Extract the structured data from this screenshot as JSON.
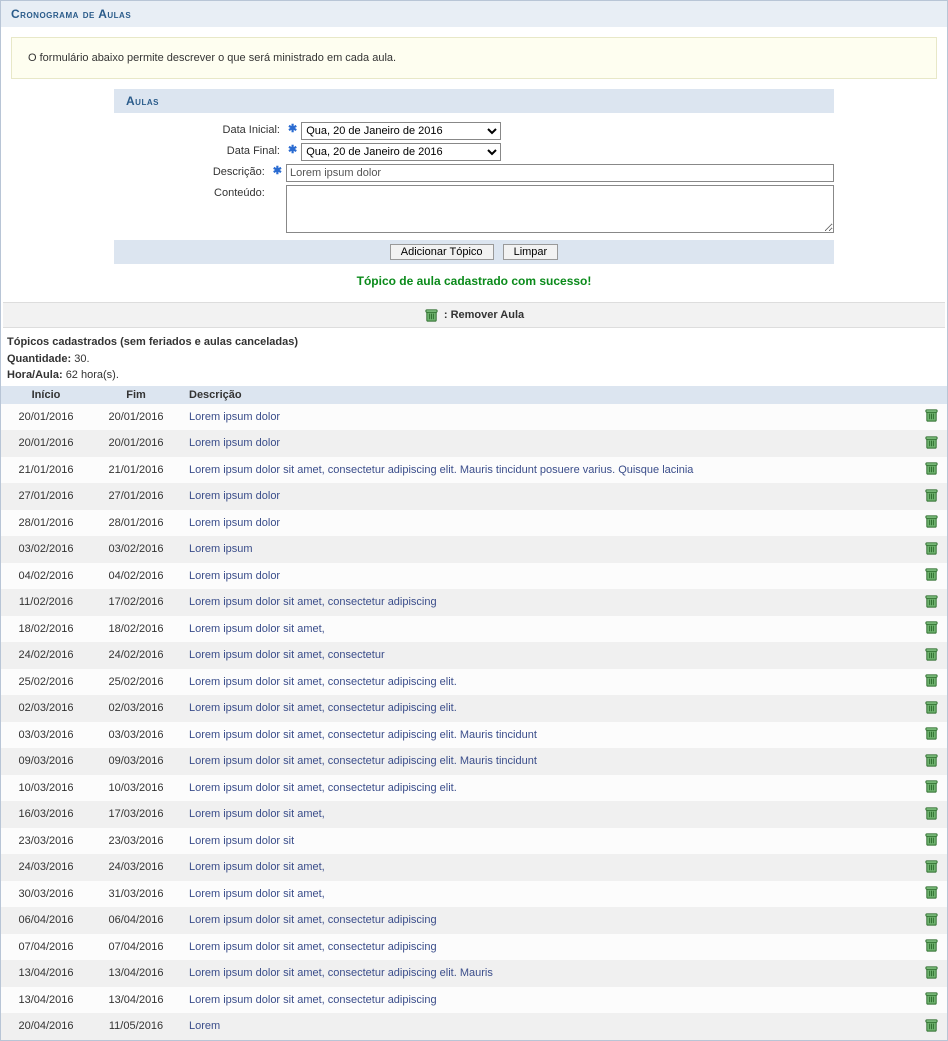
{
  "module_title": "Cronograma de Aulas",
  "info_text": "O formulário abaixo permite descrever o que será ministrado em cada aula.",
  "form": {
    "section_title": "Aulas",
    "labels": {
      "data_inicial": "Data Inicial:",
      "data_final": "Data Final:",
      "descricao": "Descrição:",
      "conteudo": "Conteúdo:"
    },
    "values": {
      "data_inicial": "Qua, 20 de Janeiro de 2016",
      "data_final": "Qua, 20 de Janeiro de 2016",
      "descricao": "Lorem ipsum dolor",
      "conteudo": ""
    },
    "buttons": {
      "adicionar": "Adicionar Tópico",
      "limpar": "Limpar"
    }
  },
  "success_message": "Tópico de aula cadastrado com sucesso!",
  "legend": {
    "remover_label": ": Remover Aula"
  },
  "meta": {
    "topicos_label": "Tópicos cadastrados (sem feriados e aulas canceladas)",
    "quantidade_label": "Quantidade: ",
    "quantidade_value": "30.",
    "hora_label": "Hora/Aula: ",
    "hora_value": "62 hora(s)."
  },
  "table": {
    "headers": {
      "inicio": "Início",
      "fim": "Fim",
      "descricao": "Descrição"
    },
    "rows": [
      {
        "inicio": "20/01/2016",
        "fim": "20/01/2016",
        "desc": "Lorem ipsum dolor"
      },
      {
        "inicio": "20/01/2016",
        "fim": "20/01/2016",
        "desc": "Lorem ipsum dolor"
      },
      {
        "inicio": "21/01/2016",
        "fim": "21/01/2016",
        "desc": "Lorem ipsum dolor sit amet, consectetur adipiscing elit. Mauris tincidunt posuere varius. Quisque lacinia"
      },
      {
        "inicio": "27/01/2016",
        "fim": "27/01/2016",
        "desc": "Lorem ipsum dolor"
      },
      {
        "inicio": "28/01/2016",
        "fim": "28/01/2016",
        "desc": "Lorem ipsum dolor"
      },
      {
        "inicio": "03/02/2016",
        "fim": "03/02/2016",
        "desc": "Lorem ipsum"
      },
      {
        "inicio": "04/02/2016",
        "fim": "04/02/2016",
        "desc": "Lorem ipsum dolor"
      },
      {
        "inicio": "11/02/2016",
        "fim": "17/02/2016",
        "desc": "Lorem ipsum dolor sit amet, consectetur adipiscing"
      },
      {
        "inicio": "18/02/2016",
        "fim": "18/02/2016",
        "desc": "Lorem ipsum dolor sit amet,"
      },
      {
        "inicio": "24/02/2016",
        "fim": "24/02/2016",
        "desc": "Lorem ipsum dolor sit amet, consectetur"
      },
      {
        "inicio": "25/02/2016",
        "fim": "25/02/2016",
        "desc": "Lorem ipsum dolor sit amet, consectetur adipiscing elit."
      },
      {
        "inicio": "02/03/2016",
        "fim": "02/03/2016",
        "desc": "Lorem ipsum dolor sit amet, consectetur adipiscing elit."
      },
      {
        "inicio": "03/03/2016",
        "fim": "03/03/2016",
        "desc": "Lorem ipsum dolor sit amet, consectetur adipiscing elit. Mauris tincidunt"
      },
      {
        "inicio": "09/03/2016",
        "fim": "09/03/2016",
        "desc": "Lorem ipsum dolor sit amet, consectetur adipiscing elit. Mauris tincidunt"
      },
      {
        "inicio": "10/03/2016",
        "fim": "10/03/2016",
        "desc": "Lorem ipsum dolor sit amet, consectetur adipiscing elit."
      },
      {
        "inicio": "16/03/2016",
        "fim": "17/03/2016",
        "desc": "Lorem ipsum dolor sit amet,"
      },
      {
        "inicio": "23/03/2016",
        "fim": "23/03/2016",
        "desc": "Lorem ipsum dolor sit"
      },
      {
        "inicio": "24/03/2016",
        "fim": "24/03/2016",
        "desc": "Lorem ipsum dolor sit amet,"
      },
      {
        "inicio": "30/03/2016",
        "fim": "31/03/2016",
        "desc": "Lorem ipsum dolor sit amet,"
      },
      {
        "inicio": "06/04/2016",
        "fim": "06/04/2016",
        "desc": "Lorem ipsum dolor sit amet, consectetur adipiscing"
      },
      {
        "inicio": "07/04/2016",
        "fim": "07/04/2016",
        "desc": "Lorem ipsum dolor sit amet, consectetur adipiscing"
      },
      {
        "inicio": "13/04/2016",
        "fim": "13/04/2016",
        "desc": "Lorem ipsum dolor sit amet, consectetur adipiscing elit. Mauris"
      },
      {
        "inicio": "13/04/2016",
        "fim": "13/04/2016",
        "desc": "Lorem ipsum dolor sit amet, consectetur adipiscing"
      },
      {
        "inicio": "20/04/2016",
        "fim": "11/05/2016",
        "desc": "Lorem"
      }
    ]
  }
}
